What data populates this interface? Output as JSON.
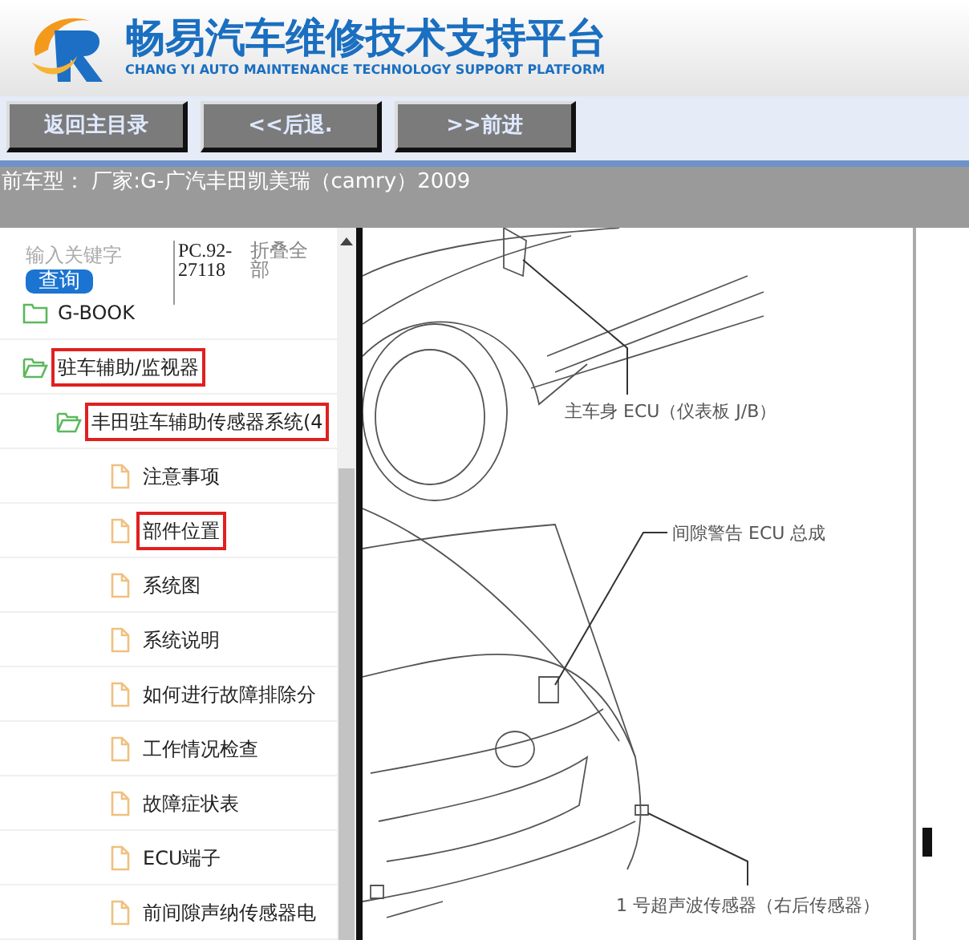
{
  "header": {
    "title": "畅易汽车维修技术支持平台",
    "subtitle": "CHANG YI AUTO MAINTENANCE TECHNOLOGY SUPPORT PLATFORM"
  },
  "nav_buttons": [
    "返回主目录",
    "<<后退.",
    ">>前进"
  ],
  "vehicle_bar": "前车型：  厂家:G-广汽丰田凯美瑞（camry）2009",
  "sidebar": {
    "search": {
      "placeholder": "输入关键字"
    },
    "search_button": "查询",
    "code": "PC.92-27118",
    "collapse_all": "折叠全部",
    "tree": [
      {
        "label": "G-BOOK",
        "kind": "folder",
        "expanded": false,
        "marked": false
      },
      {
        "label": "驻车辅助/监视器",
        "kind": "folder",
        "expanded": true,
        "marked": true,
        "children": [
          {
            "label": "丰田驻车辅助传感器系统(4",
            "kind": "folder",
            "expanded": true,
            "marked": true,
            "children": [
              {
                "label": "注意事项",
                "kind": "doc",
                "marked": false
              },
              {
                "label": "部件位置",
                "kind": "doc",
                "marked": true
              },
              {
                "label": "系统图",
                "kind": "doc",
                "marked": false
              },
              {
                "label": "系统说明",
                "kind": "doc",
                "marked": false
              },
              {
                "label": "如何进行故障排除分",
                "kind": "doc",
                "marked": false
              },
              {
                "label": "工作情况检查",
                "kind": "doc",
                "marked": false
              },
              {
                "label": "故障症状表",
                "kind": "doc",
                "marked": false
              },
              {
                "label": "ECU端子",
                "kind": "doc",
                "marked": false
              },
              {
                "label": "前间隙声纳传感器电",
                "kind": "doc",
                "marked": false
              }
            ]
          }
        ]
      }
    ]
  },
  "diagram": {
    "callouts": [
      "主车身 ECU（仪表板 J/B）",
      "间隙警告 ECU 总成",
      "1 号超声波传感器（右后传感器）"
    ]
  }
}
